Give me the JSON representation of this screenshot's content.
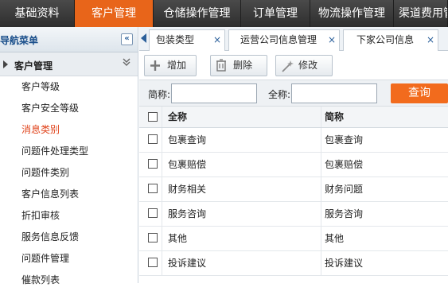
{
  "topnav": {
    "items": [
      "基础资料",
      "客户管理",
      "仓储操作管理",
      "订单管理",
      "物流操作管理",
      "渠道费用管"
    ]
  },
  "sidebar": {
    "title": "导航菜单",
    "collapse_icon": "«",
    "group_label": "客户管理",
    "group_toggle": "»",
    "items": [
      "客户等级",
      "客户安全等级",
      "消息类别",
      "问题件处理类型",
      "问题件类别",
      "客户信息列表",
      "折扣审核",
      "服务信息反馈",
      "问题件管理",
      "催款列表"
    ]
  },
  "tabs": [
    {
      "label": "包装类型",
      "close": "×"
    },
    {
      "label": "运营公司信息管理",
      "close": "×"
    },
    {
      "label": "下家公司信息",
      "close": "×"
    }
  ],
  "toolbar": {
    "add_label": "增加",
    "delete_label": "删除",
    "edit_label": "修改"
  },
  "search": {
    "short_name_label": "简称:",
    "full_name_label": "全称:",
    "short_name_value": "",
    "full_name_value": "",
    "query_label": "查询"
  },
  "grid": {
    "columns": [
      "全称",
      "简称"
    ],
    "rows": [
      [
        "包裹查询",
        "包裹查询"
      ],
      [
        "包裹赔偿",
        "包裹赔偿"
      ],
      [
        "财务相关",
        "财务问题"
      ],
      [
        "服务咨询",
        "服务咨询"
      ],
      [
        "其他",
        "其他"
      ],
      [
        "投诉建议",
        "投诉建议"
      ]
    ]
  },
  "colors": {
    "accent": "#e8651a",
    "active_menu": "#e0441c"
  }
}
